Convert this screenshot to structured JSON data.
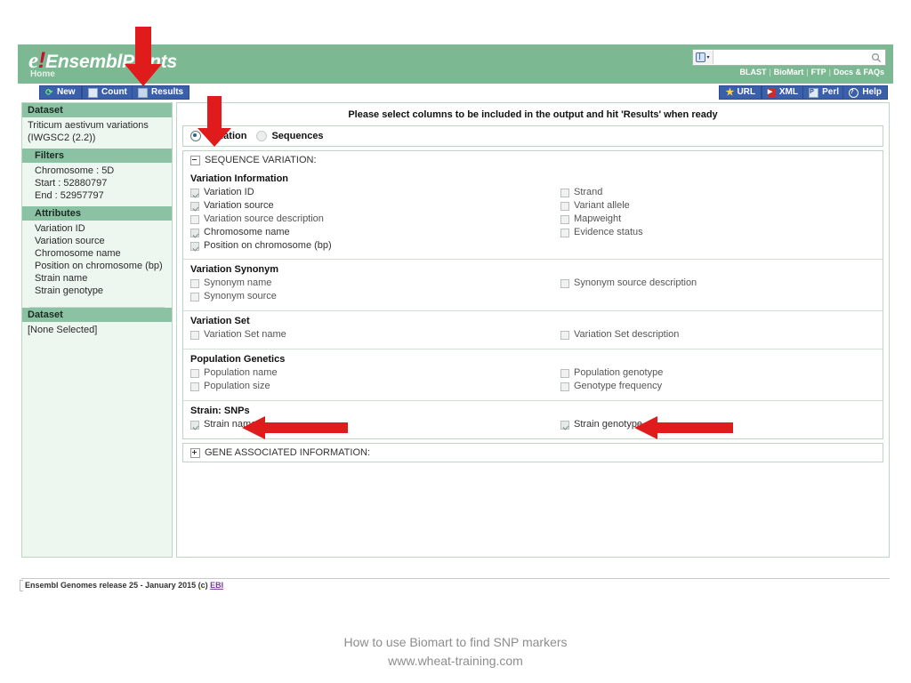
{
  "header": {
    "logo_text": "EnsemblPlants",
    "logo_initial": "e",
    "logo_bang": "!",
    "home_label": "Home",
    "search_value": "",
    "search_placeholder": "",
    "nav_links": [
      "BLAST",
      "BioMart",
      "FTP",
      "Docs & FAQs"
    ],
    "nav_separator": "|"
  },
  "toolbar": {
    "left_buttons": [
      {
        "label": "New",
        "icon": "refresh-icon"
      },
      {
        "label": "Count",
        "icon": "count-icon"
      },
      {
        "label": "Results",
        "icon": "results-icon"
      }
    ],
    "right_buttons": [
      {
        "label": "URL",
        "icon": "star-icon"
      },
      {
        "label": "XML",
        "icon": "xml-icon"
      },
      {
        "label": "Perl",
        "icon": "perl-icon"
      },
      {
        "label": "Help",
        "icon": "help-icon"
      }
    ]
  },
  "sidebar": {
    "dataset_header": "Dataset",
    "dataset_name_line1": "Triticum aestivum variations",
    "dataset_name_line2": "(IWGSC2 (2.2))",
    "filters_header": "Filters",
    "filters": [
      "Chromosome : 5D",
      "Start : 52880797",
      "End : 52957797"
    ],
    "attributes_header": "Attributes",
    "attributes": [
      "Variation ID",
      "Variation source",
      "Chromosome name",
      "Position on chromosome (bp)",
      "Strain name",
      "Strain genotype"
    ],
    "dataset2_header": "Dataset",
    "dataset2_value": "[None Selected]"
  },
  "main": {
    "title": "Please select columns to be included in the output and hit 'Results' when ready",
    "mode_options": [
      {
        "label": "Variation",
        "selected": true
      },
      {
        "label": "Sequences",
        "selected": false
      }
    ],
    "sections": [
      {
        "label": "SEQUENCE VARIATION:",
        "expanded": true
      },
      {
        "label": "GENE ASSOCIATED INFORMATION:",
        "expanded": false
      }
    ],
    "groups": [
      {
        "title": "Variation Information",
        "left": [
          {
            "label": "Variation ID",
            "checked": true
          },
          {
            "label": "Variation source",
            "checked": true
          },
          {
            "label": "Variation source description",
            "checked": false
          },
          {
            "label": "Chromosome name",
            "checked": true
          },
          {
            "label": "Position on chromosome (bp)",
            "checked": true
          }
        ],
        "right": [
          {
            "label": "Strand",
            "checked": false
          },
          {
            "label": "Variant allele",
            "checked": false
          },
          {
            "label": "Mapweight",
            "checked": false
          },
          {
            "label": "Evidence status",
            "checked": false
          }
        ]
      },
      {
        "title": "Variation Synonym",
        "left": [
          {
            "label": "Synonym name",
            "checked": false
          },
          {
            "label": "Synonym source",
            "checked": false
          }
        ],
        "right": [
          {
            "label": "Synonym source description",
            "checked": false
          }
        ]
      },
      {
        "title": "Variation Set",
        "left": [
          {
            "label": "Variation Set name",
            "checked": false
          }
        ],
        "right": [
          {
            "label": "Variation Set description",
            "checked": false
          }
        ]
      },
      {
        "title": "Population Genetics",
        "left": [
          {
            "label": "Population name",
            "checked": false
          },
          {
            "label": "Population size",
            "checked": false
          }
        ],
        "right": [
          {
            "label": "Population genotype",
            "checked": false
          },
          {
            "label": "Genotype frequency",
            "checked": false
          }
        ]
      },
      {
        "title": "Strain: SNPs",
        "left": [
          {
            "label": "Strain name",
            "checked": true
          }
        ],
        "right": [
          {
            "label": "Strain genotype",
            "checked": true
          }
        ]
      }
    ]
  },
  "footer": {
    "text": "Ensembl Genomes release 25 - January 2015 (c) ",
    "link": "EBI"
  },
  "caption": {
    "line1": "How to use Biomart to find SNP markers",
    "line2": "www.wheat-training.com"
  },
  "annotations": {
    "arrow_color": "#e01b1b",
    "arrows": [
      {
        "name": "arrow-to-results-button",
        "direction": "down"
      },
      {
        "name": "arrow-to-variation-radio",
        "direction": "down"
      },
      {
        "name": "arrow-to-strain-name-checkbox",
        "direction": "left"
      },
      {
        "name": "arrow-to-strain-genotype-checkbox",
        "direction": "left"
      }
    ]
  },
  "colors": {
    "banner_green": "#7cb992",
    "section_green": "#8cc2a4",
    "panel_bg": "#eef6f0",
    "button_blue": "#3a5fab"
  }
}
